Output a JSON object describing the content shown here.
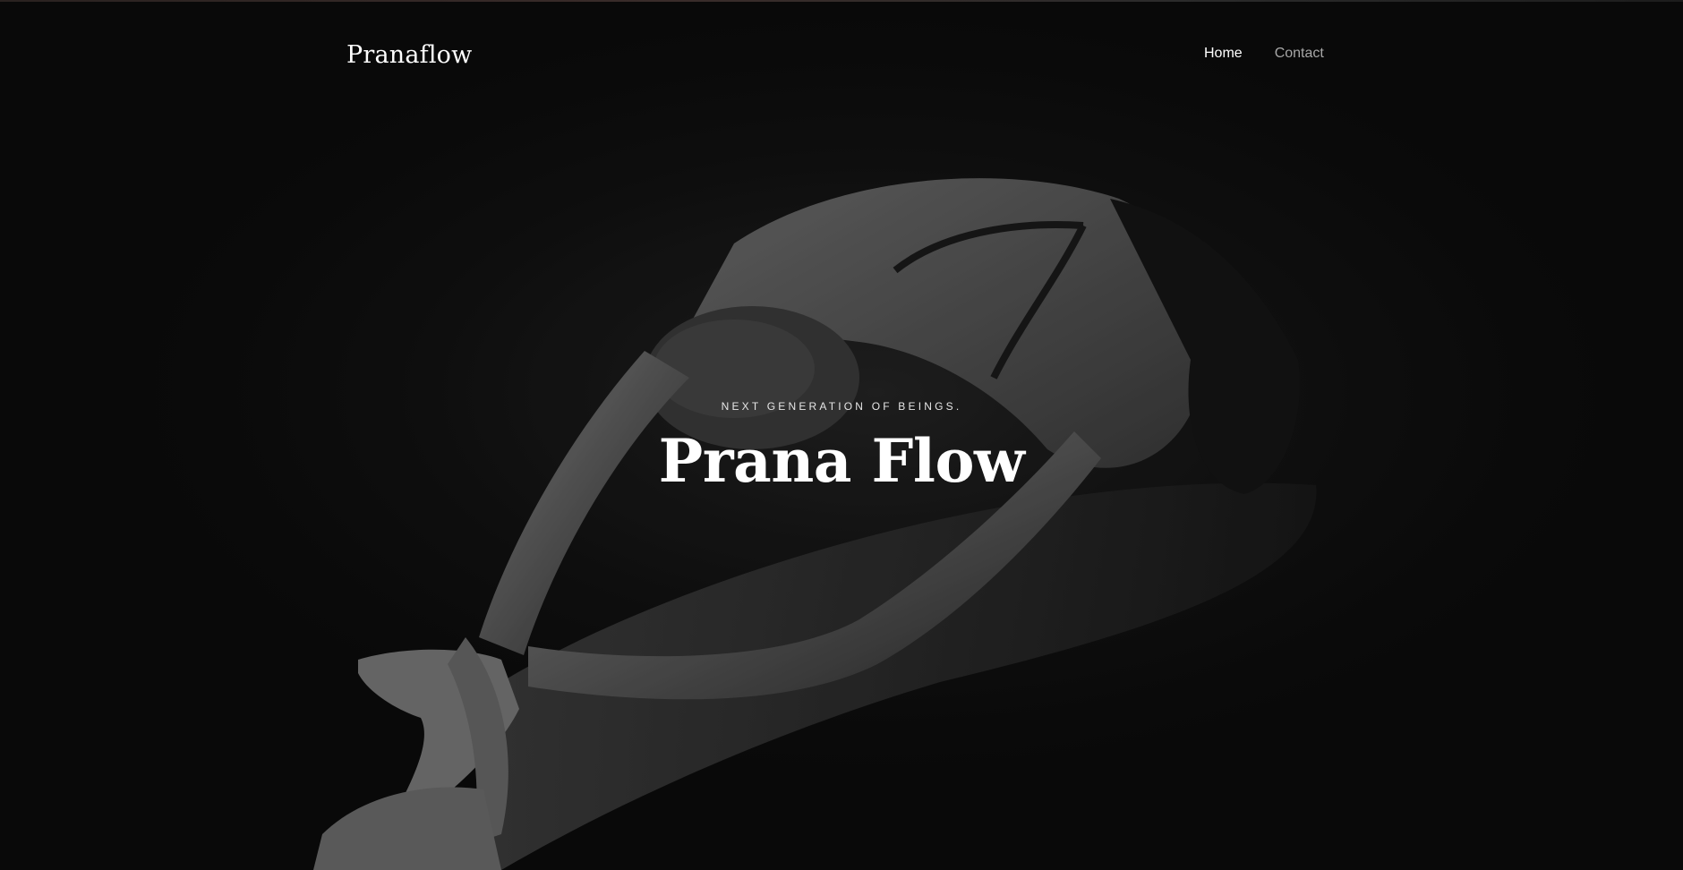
{
  "site": {
    "logo": "Pranaflow"
  },
  "nav": {
    "items": [
      {
        "label": "Home",
        "state": "active"
      },
      {
        "label": "Contact",
        "state": "inactive"
      }
    ]
  },
  "hero": {
    "eyebrow": "NEXT GENERATION OF BEINGS.",
    "title": "Prana Flow",
    "image": "black-and-white photo of a person in a seated forward fold yoga pose"
  },
  "colors": {
    "background": "#0b0b0b",
    "text_primary": "#ffffff",
    "nav_muted": "#a7a7a7"
  }
}
